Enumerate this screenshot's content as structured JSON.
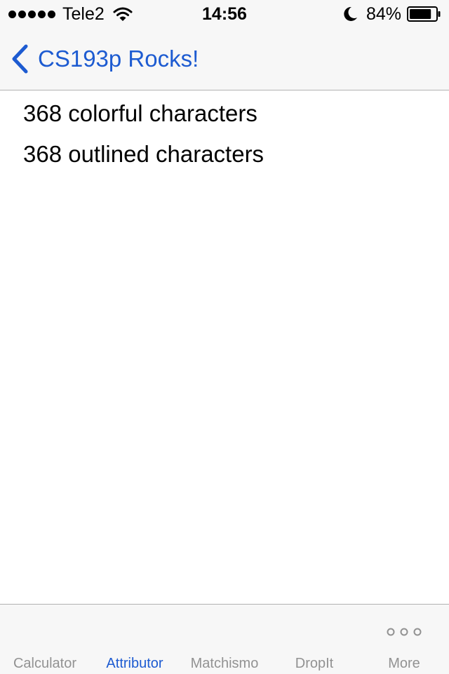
{
  "status_bar": {
    "carrier": "Tele2",
    "time": "14:56",
    "battery_percent": "84%",
    "battery_level": 0.84,
    "signal_bars": 5,
    "icons": [
      "signal-dots",
      "wifi-icon",
      "moon-icon",
      "battery-icon"
    ]
  },
  "nav": {
    "back_label": "CS193p Rocks!",
    "back_icon": "chevron-left-icon"
  },
  "content": {
    "rows": [
      "368 colorful characters",
      "368 outlined characters"
    ]
  },
  "tab_bar": {
    "selected_index": 1,
    "items": [
      {
        "label": "Calculator"
      },
      {
        "label": "Attributor"
      },
      {
        "label": "Matchismo"
      },
      {
        "label": "DropIt"
      },
      {
        "label": "More",
        "icon": "more-icon"
      }
    ]
  },
  "colors": {
    "accent": "#1d5bd1",
    "tab_inactive": "#929292",
    "bar_background": "#f7f7f7",
    "separator": "#b2b2b2"
  }
}
